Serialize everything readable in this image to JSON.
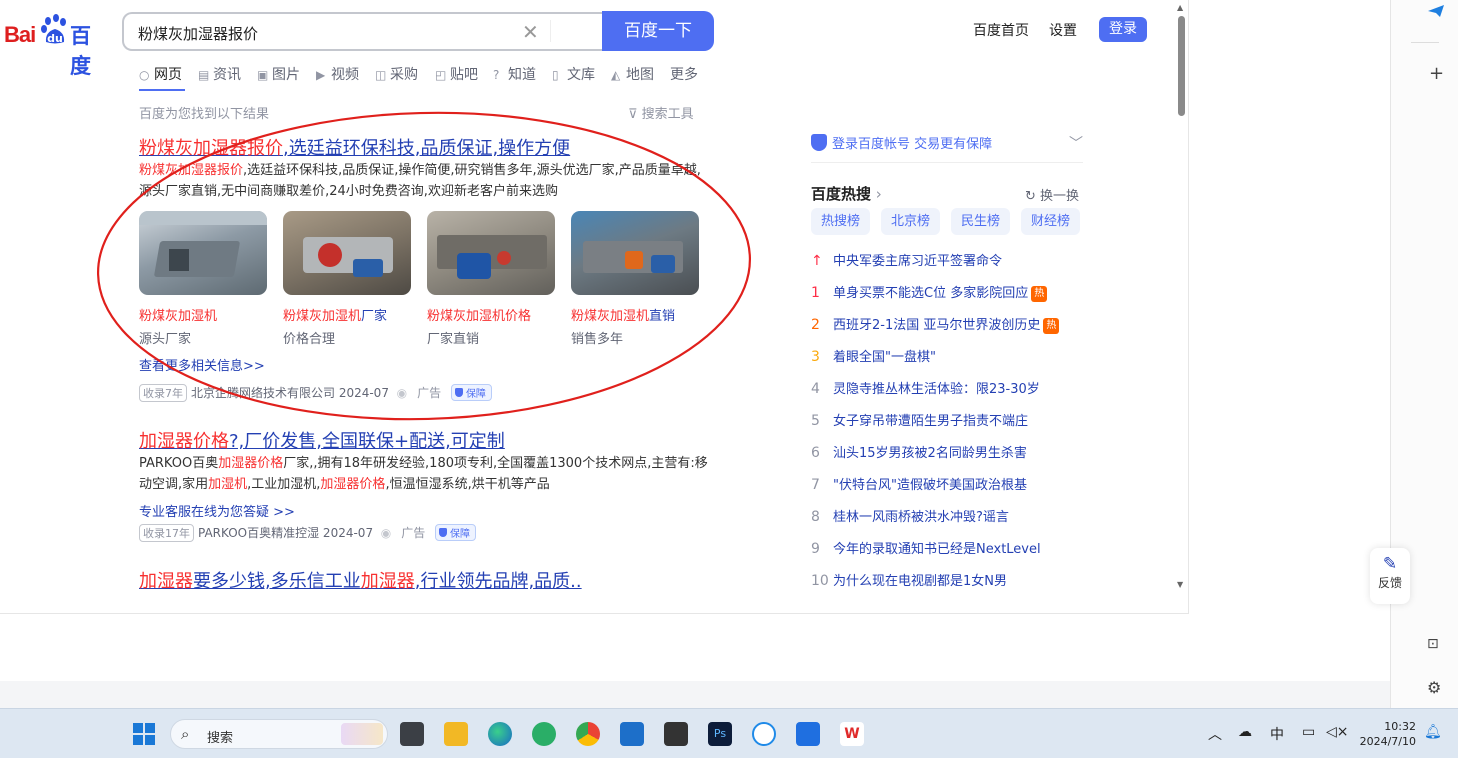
{
  "logo": {
    "bai": "Bai",
    "du": "百度"
  },
  "search": {
    "query": "粉煤灰加湿器报价",
    "button": "百度一下"
  },
  "toplinks": {
    "home": "百度首页",
    "settings": "设置",
    "login": "登录"
  },
  "tabs": [
    "网页",
    "资讯",
    "图片",
    "视频",
    "采购",
    "贴吧",
    "知道",
    "文库",
    "地图",
    "更多"
  ],
  "found_text": "百度为您找到以下结果",
  "search_tools": "搜索工具",
  "result1": {
    "title_em": "粉煤灰加湿器报价",
    "title_rest": ",选廷益环保科技,品质保证,操作方便",
    "abs_em": "粉煤灰加湿器报价",
    "abs_rest1": ",选廷益环保科技,品质保证,操作简便,研究销售多年,源头优选厂家,产品质量卓越,",
    "abs_line2": "源头厂家直销,无中间商赚取差价,24小时免费咨询,欢迎新老客户前来选购",
    "thumbs": [
      {
        "em": "粉煤灰加湿机",
        "rest": "",
        "sub": "源头厂家"
      },
      {
        "em": "粉煤灰加湿机",
        "rest": "厂家",
        "sub": "价格合理"
      },
      {
        "em": "粉煤灰加湿机价格",
        "rest": "",
        "sub": "厂家直销"
      },
      {
        "em": "粉煤灰加湿机",
        "rest": "直销",
        "sub": "销售多年"
      }
    ],
    "more": "查看更多相关信息>>",
    "badge": "收录7年",
    "company": "北京企腾网络技术有限公司 2024-07",
    "ad": "广告",
    "protect": "保障"
  },
  "result2": {
    "title_em": "加湿器价格",
    "title_rest": "?,厂价发售,全国联保+配送,可定制",
    "abs_a": "PARKOO百奥",
    "abs_b": "加湿器价格",
    "abs_c": "厂家,,拥有18年研发经验,180项专利,全国覆盖1300个技术网点,主营有:移",
    "abs_d": "动空调,家用",
    "abs_e": "加湿机",
    "abs_f": ",工业加湿机,",
    "abs_g": "加湿器价格",
    "abs_h": ",恒温恒湿系统,烘干机等产品",
    "more": "专业客服在线为您答疑 >>",
    "badge": "收录17年",
    "company": "PARKOO百奥精准控湿 2024-07",
    "ad": "广告",
    "protect": "保障"
  },
  "result3": {
    "t1": "加湿器",
    "t2": "要多少钱,多乐信工业",
    "t3": "加湿器",
    "t4": ",行业领先品牌,品质.."
  },
  "right": {
    "account": "登录百度帐号 交易更有保障",
    "hot_title": "百度热搜",
    "refresh": "换一换",
    "pills": [
      "热搜榜",
      "北京榜",
      "民生榜",
      "财经榜"
    ],
    "hot": [
      {
        "n": "↑",
        "text": "中央军委主席习近平签署命令",
        "tag": ""
      },
      {
        "n": "1",
        "text": "单身买票不能选C位 多家影院回应",
        "tag": "热"
      },
      {
        "n": "2",
        "text": "西班牙2-1法国 亚马尔世界波创历史",
        "tag": "热"
      },
      {
        "n": "3",
        "text": "着眼全国\"一盘棋\"",
        "tag": ""
      },
      {
        "n": "4",
        "text": "灵隐寺推丛林生活体验：限23-30岁",
        "tag": ""
      },
      {
        "n": "5",
        "text": "女子穿吊带遭陌生男子指责不端庄",
        "tag": ""
      },
      {
        "n": "6",
        "text": "汕头15岁男孩被2名同龄男生杀害",
        "tag": ""
      },
      {
        "n": "7",
        "text": "\"伏特台风\"造假破坏美国政治根基",
        "tag": ""
      },
      {
        "n": "8",
        "text": "桂林一风雨桥被洪水冲毁?谣言",
        "tag": ""
      },
      {
        "n": "9",
        "text": "今年的录取通知书已经是NextLevel",
        "tag": ""
      },
      {
        "n": "10",
        "text": "为什么现在电视剧都是1女N男",
        "tag": ""
      }
    ],
    "rank_colors": {
      "top": "#fe2d46",
      "1": "#fe2d46",
      "2": "#ff6600",
      "3": "#faa90e",
      "rest": "#9195a3"
    }
  },
  "feedback": "反馈",
  "taskbar": {
    "search": "搜索",
    "ime": "中",
    "time": "10:32",
    "date": "2024/7/10"
  }
}
